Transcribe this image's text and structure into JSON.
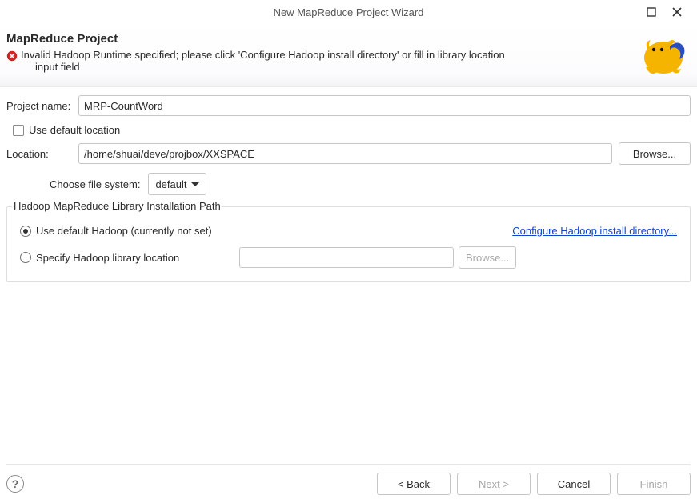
{
  "window": {
    "title": "New MapReduce Project Wizard"
  },
  "banner": {
    "heading": "MapReduce Project",
    "error_line1": "Invalid Hadoop Runtime specified; please click 'Configure Hadoop install directory' or fill in library location",
    "error_line2": "input field"
  },
  "form": {
    "project_name_label": "Project name:",
    "project_name_value": "MRP-CountWord",
    "use_default_location_label": "Use default location",
    "use_default_location_checked": false,
    "location_label": "Location:",
    "location_value": "/home/shuai/deve/projbox/XXSPACE",
    "browse_label": "Browse...",
    "choose_fs_label": "Choose file system:",
    "fs_value": "default"
  },
  "group": {
    "title": "Hadoop MapReduce Library Installation Path",
    "radio_default_label": "Use default Hadoop (currently not set)",
    "radio_specify_label": "Specify Hadoop library location",
    "radio_selected": "default",
    "configure_link": "Configure Hadoop install directory...",
    "hadoop_path_value": "",
    "browse_label": "Browse..."
  },
  "footer": {
    "back_label": "< Back",
    "next_label": "Next >",
    "cancel_label": "Cancel",
    "finish_label": "Finish"
  }
}
